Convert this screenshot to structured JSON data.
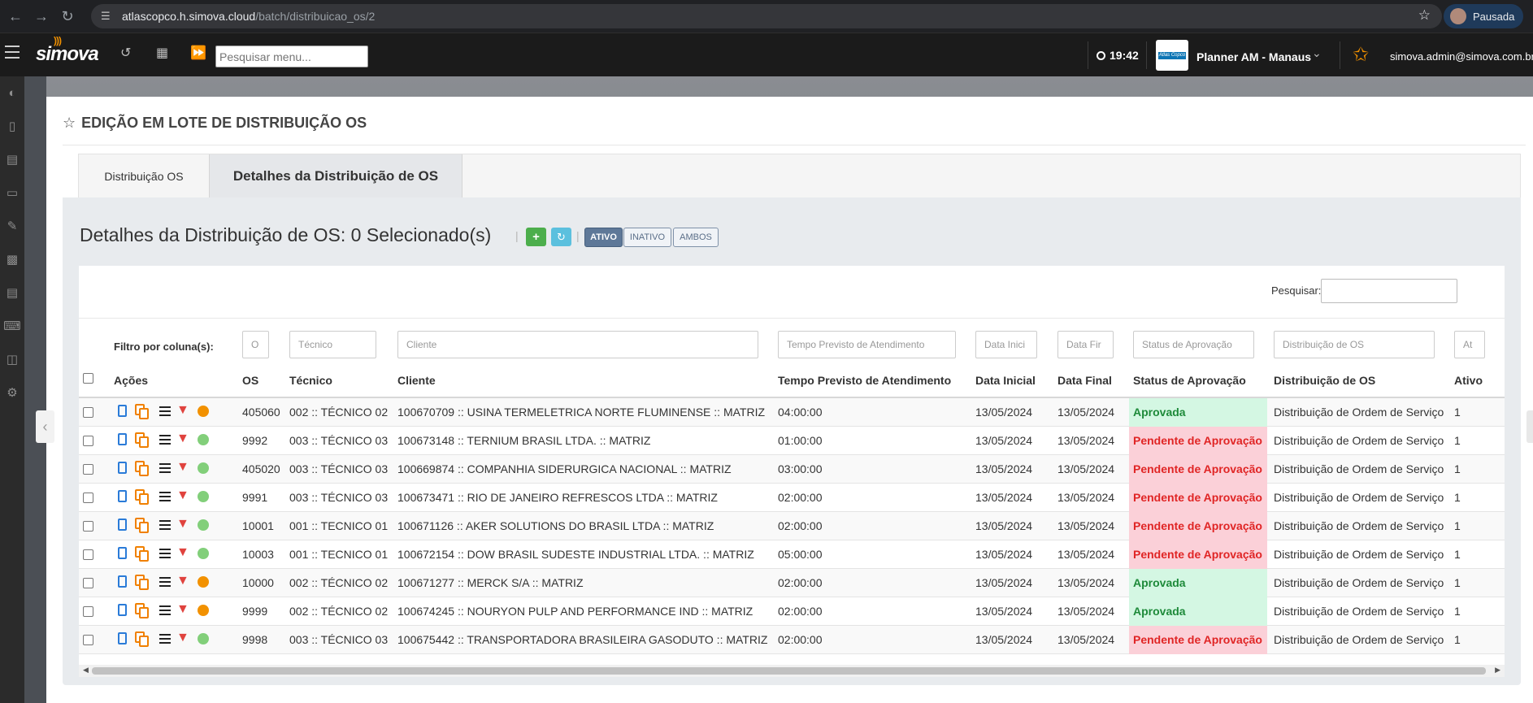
{
  "browser": {
    "url_host": "atlascopco.h.simova.cloud",
    "url_path": "/batch/distribuicao_os/2",
    "profile_label": "Pausada"
  },
  "topbar": {
    "logo": "simova",
    "search_placeholder": "Pesquisar menu...",
    "time": "19:42",
    "company_logo_text": "Atlas Copco",
    "planner": "Planner AM - Manaus",
    "user_email": "simova.admin@simova.com.br"
  },
  "page": {
    "title": "EDIÇÃO EM LOTE DE DISTRIBUIÇÃO OS",
    "tabs": [
      "Distribuição OS",
      "Detalhes da Distribuição de OS"
    ],
    "content_title": "Detalhes da Distribuição de OS: 0 Selecionado(s)",
    "filters": [
      "ATIVO",
      "INATIVO",
      "AMBOS"
    ],
    "search_label": "Pesquisar:",
    "filter_by_column_label": "Filtro por coluna(s):"
  },
  "column_filters": [
    "O",
    "Técnico",
    "Cliente",
    "Tempo Previsto de Atendimento",
    "Data Inici",
    "Data Fir",
    "Status de Aprovação",
    "Distribuição de OS",
    "At"
  ],
  "columns": [
    "Ações",
    "OS",
    "Técnico",
    "Cliente",
    "Tempo Previsto de Atendimento",
    "Data Inicial",
    "Data Final",
    "Status de Aprovação",
    "Distribuição de OS",
    "Ativo"
  ],
  "rows": [
    {
      "os": "405060",
      "tecnico": "002 :: TÉCNICO 02",
      "cliente": "100670709 :: USINA TERMELETRICA NORTE FLUMINENSE :: MATRIZ",
      "tempo": "04:00:00",
      "inicio": "13/05/2024",
      "fim": "13/05/2024",
      "status": "Aprovada",
      "status_type": "ok",
      "dist": "Distribuição de Ordem de Serviço",
      "ativo": "1",
      "dot": "orange"
    },
    {
      "os": "9992",
      "tecnico": "003 :: TÉCNICO 03",
      "cliente": "100673148 :: TERNIUM BRASIL LTDA. :: MATRIZ",
      "tempo": "01:00:00",
      "inicio": "13/05/2024",
      "fim": "13/05/2024",
      "status": "Pendente de Aprovação",
      "status_type": "pend",
      "dist": "Distribuição de Ordem de Serviço",
      "ativo": "1",
      "dot": "green"
    },
    {
      "os": "405020",
      "tecnico": "003 :: TÉCNICO 03",
      "cliente": "100669874 :: COMPANHIA SIDERURGICA NACIONAL :: MATRIZ",
      "tempo": "03:00:00",
      "inicio": "13/05/2024",
      "fim": "13/05/2024",
      "status": "Pendente de Aprovação",
      "status_type": "pend",
      "dist": "Distribuição de Ordem de Serviço",
      "ativo": "1",
      "dot": "green"
    },
    {
      "os": "9991",
      "tecnico": "003 :: TÉCNICO 03",
      "cliente": "100673471 :: RIO DE JANEIRO REFRESCOS LTDA :: MATRIZ",
      "tempo": "02:00:00",
      "inicio": "13/05/2024",
      "fim": "13/05/2024",
      "status": "Pendente de Aprovação",
      "status_type": "pend",
      "dist": "Distribuição de Ordem de Serviço",
      "ativo": "1",
      "dot": "green"
    },
    {
      "os": "10001",
      "tecnico": "001 :: TECNICO 01",
      "cliente": "100671126 :: AKER SOLUTIONS DO BRASIL LTDA :: MATRIZ",
      "tempo": "02:00:00",
      "inicio": "13/05/2024",
      "fim": "13/05/2024",
      "status": "Pendente de Aprovação",
      "status_type": "pend",
      "dist": "Distribuição de Ordem de Serviço",
      "ativo": "1",
      "dot": "green"
    },
    {
      "os": "10003",
      "tecnico": "001 :: TECNICO 01",
      "cliente": "100672154 :: DOW BRASIL SUDESTE INDUSTRIAL LTDA. :: MATRIZ",
      "tempo": "05:00:00",
      "inicio": "13/05/2024",
      "fim": "13/05/2024",
      "status": "Pendente de Aprovação",
      "status_type": "pend",
      "dist": "Distribuição de Ordem de Serviço",
      "ativo": "1",
      "dot": "green"
    },
    {
      "os": "10000",
      "tecnico": "002 :: TÉCNICO 02",
      "cliente": "100671277 :: MERCK S/A :: MATRIZ",
      "tempo": "02:00:00",
      "inicio": "13/05/2024",
      "fim": "13/05/2024",
      "status": "Aprovada",
      "status_type": "ok",
      "dist": "Distribuição de Ordem de Serviço",
      "ativo": "1",
      "dot": "orange"
    },
    {
      "os": "9999",
      "tecnico": "002 :: TÉCNICO 02",
      "cliente": "100674245 :: NOURYON PULP AND PERFORMANCE IND :: MATRIZ",
      "tempo": "02:00:00",
      "inicio": "13/05/2024",
      "fim": "13/05/2024",
      "status": "Aprovada",
      "status_type": "ok",
      "dist": "Distribuição de Ordem de Serviço",
      "ativo": "1",
      "dot": "orange"
    },
    {
      "os": "9998",
      "tecnico": "003 :: TÉCNICO 03",
      "cliente": "100675442 :: TRANSPORTADORA BRASILEIRA GASODUTO :: MATRIZ",
      "tempo": "02:00:00",
      "inicio": "13/05/2024",
      "fim": "13/05/2024",
      "status": "Pendente de Aprovação",
      "status_type": "pend",
      "dist": "Distribuição de Ordem de Serviço",
      "ativo": "1",
      "dot": "green"
    }
  ],
  "colors": {
    "approved_bg": "#d4f7e3",
    "approved_text": "#1e8a3a",
    "pending_bg": "#fbd0d8",
    "pending_text": "#e02525",
    "accent_orange": "#f29100",
    "add_green": "#4cae4c",
    "refresh_blue": "#5bc0de"
  },
  "icons": {
    "row_actions": [
      "edit-icon",
      "duplicate-icon",
      "details-list-icon",
      "reject-thumbs-down-icon",
      "status-dot-icon"
    ],
    "sidebar": [
      "dashboard-icon",
      "map-icon",
      "calendar-icon",
      "mobile-icon",
      "edit-icon",
      "chart-icon",
      "document-icon",
      "keyboard-icon",
      "database-icon",
      "settings-icon"
    ]
  }
}
